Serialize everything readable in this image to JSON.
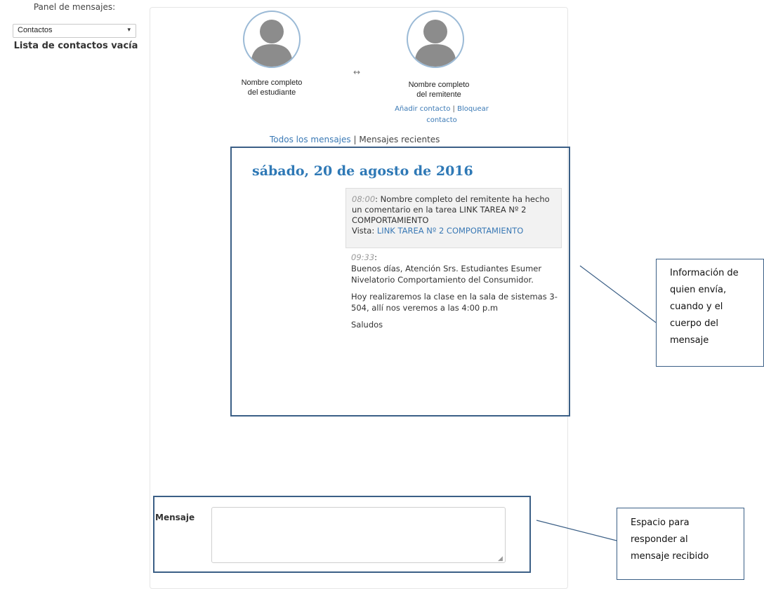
{
  "sidebar": {
    "panel_label": "Panel de mensajes:",
    "contacts_select": {
      "value": "Contactos",
      "caret": "▾"
    },
    "empty_list_text": "Lista de contactos vacía"
  },
  "conversation": {
    "student_name_line1": "Nombre completo",
    "student_name_line2": "del estudiante",
    "sender_name_line1": "Nombre completo",
    "sender_name_line2": "del remitente",
    "exchange_icon": "↔",
    "add_contact": "Añadir contacto",
    "separator": "|",
    "block_contact_line1": "Bloquear",
    "block_contact_line2": "contacto",
    "all_messages": "Todos los mensajes",
    "recent_messages": "Mensajes recientes"
  },
  "messages": {
    "day_heading": "sábado, 20 de agosto de 2016",
    "notification": {
      "time": "08:00",
      "text": ": Nombre completo del remitente ha hecho un comentario en la tarea LINK TAREA Nº 2 COMPORTAMIENTO",
      "view_label": "Vista:",
      "view_link": "LINK TAREA Nº 2 COMPORTAMIENTO"
    },
    "reply": {
      "time": "09:33",
      "colon": ":",
      "paragraph1": "Buenos días, Atención Srs. Estudiantes Esumer Nivelatorio Comportamiento del Consumidor.",
      "paragraph2": "Hoy realizaremos la clase en la sala de sistemas 3-504, allí nos veremos a las 4:00 p.m",
      "paragraph3": "Saludos"
    }
  },
  "compose": {
    "label": "Mensaje",
    "value": "",
    "resize_grip": "◢"
  },
  "callouts": {
    "info_line1": "Información de",
    "info_line2": "quien envía,",
    "info_line3": "cuando y el",
    "info_line4": "cuerpo del",
    "info_line5": "mensaje",
    "reply_line1": "Espacio para",
    "reply_line2": "responder al",
    "reply_line3": "mensaje recibido"
  },
  "colors": {
    "link": "#3a79b5",
    "heading": "#2f79b6",
    "callout_border": "#3b5f86"
  },
  "icons": {
    "avatar": "user-avatar-icon",
    "exchange": "bidirectional-arrow-icon",
    "dropdown": "chevron-down-icon"
  }
}
